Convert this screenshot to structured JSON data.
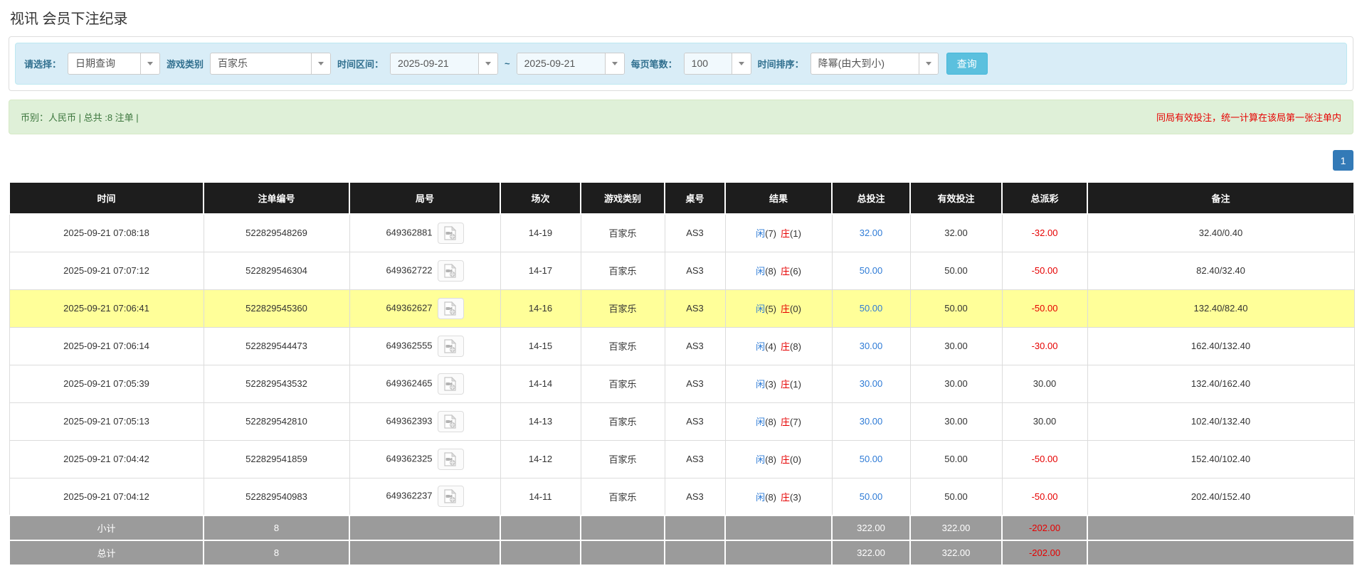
{
  "page": {
    "title": "视讯 会员下注纪录"
  },
  "colors": {
    "accent_button_blue": "#5bc0de",
    "pagination_blue": "#337ab7",
    "link_blue": "#2e7bd6",
    "negative_red": "#e60000",
    "highlight_yellow": "#ffff99",
    "header_black": "#1d1d1d",
    "footer_gray": "#9b9b9b",
    "filter_bg": "#d9edf7",
    "summary_bg": "#dff0d8"
  },
  "filters": {
    "select_label": "请选择：",
    "select_value": "日期查询",
    "game_label": "游戏类别",
    "game_value": "百家乐",
    "range_label": "时间区间：",
    "date_from": "2025-09-21",
    "date_separator": "~",
    "date_to": "2025-09-21",
    "page_size_label": "每页笔数：",
    "page_size_value": "100",
    "sort_label": "时间排序：",
    "sort_value": "降幂(由大到小)",
    "search_button": "查询"
  },
  "summary": {
    "left_text": "币别：人民币 | 总共 :8 注单 |",
    "notice": "同局有效投注，统一计算在该局第一张注单内"
  },
  "pagination": {
    "current": "1"
  },
  "table": {
    "headers": [
      "时间",
      "注单编号",
      "局号",
      "场次",
      "游戏类别",
      "桌号",
      "结果",
      "总投注",
      "有效投注",
      "总派彩",
      "备注"
    ],
    "rows": [
      {
        "time": "2025-09-21 07:08:18",
        "bet_id": "522829548269",
        "round_id": "649362881",
        "session": "14-19",
        "game": "百家乐",
        "table_no": "AS3",
        "player": "闲",
        "player_score": "(7)",
        "banker": "庄",
        "banker_score": "(1)",
        "total_bet": "32.00",
        "valid_bet": "32.00",
        "payout": "-32.00",
        "note": "32.40/0.40",
        "highlight": false
      },
      {
        "time": "2025-09-21 07:07:12",
        "bet_id": "522829546304",
        "round_id": "649362722",
        "session": "14-17",
        "game": "百家乐",
        "table_no": "AS3",
        "player": "闲",
        "player_score": "(8)",
        "banker": "庄",
        "banker_score": "(6)",
        "total_bet": "50.00",
        "valid_bet": "50.00",
        "payout": "-50.00",
        "note": "82.40/32.40",
        "highlight": false
      },
      {
        "time": "2025-09-21 07:06:41",
        "bet_id": "522829545360",
        "round_id": "649362627",
        "session": "14-16",
        "game": "百家乐",
        "table_no": "AS3",
        "player": "闲",
        "player_score": "(5)",
        "banker": "庄",
        "banker_score": "(0)",
        "total_bet": "50.00",
        "valid_bet": "50.00",
        "payout": "-50.00",
        "note": "132.40/82.40",
        "highlight": true
      },
      {
        "time": "2025-09-21 07:06:14",
        "bet_id": "522829544473",
        "round_id": "649362555",
        "session": "14-15",
        "game": "百家乐",
        "table_no": "AS3",
        "player": "闲",
        "player_score": "(4)",
        "banker": "庄",
        "banker_score": "(8)",
        "total_bet": "30.00",
        "valid_bet": "30.00",
        "payout": "-30.00",
        "note": "162.40/132.40",
        "highlight": false
      },
      {
        "time": "2025-09-21 07:05:39",
        "bet_id": "522829543532",
        "round_id": "649362465",
        "session": "14-14",
        "game": "百家乐",
        "table_no": "AS3",
        "player": "闲",
        "player_score": "(3)",
        "banker": "庄",
        "banker_score": "(1)",
        "total_bet": "30.00",
        "valid_bet": "30.00",
        "payout": "30.00",
        "note": "132.40/162.40",
        "highlight": false
      },
      {
        "time": "2025-09-21 07:05:13",
        "bet_id": "522829542810",
        "round_id": "649362393",
        "session": "14-13",
        "game": "百家乐",
        "table_no": "AS3",
        "player": "闲",
        "player_score": "(8)",
        "banker": "庄",
        "banker_score": "(7)",
        "total_bet": "30.00",
        "valid_bet": "30.00",
        "payout": "30.00",
        "note": "102.40/132.40",
        "highlight": false
      },
      {
        "time": "2025-09-21 07:04:42",
        "bet_id": "522829541859",
        "round_id": "649362325",
        "session": "14-12",
        "game": "百家乐",
        "table_no": "AS3",
        "player": "闲",
        "player_score": "(8)",
        "banker": "庄",
        "banker_score": "(0)",
        "total_bet": "50.00",
        "valid_bet": "50.00",
        "payout": "-50.00",
        "note": "152.40/102.40",
        "highlight": false
      },
      {
        "time": "2025-09-21 07:04:12",
        "bet_id": "522829540983",
        "round_id": "649362237",
        "session": "14-11",
        "game": "百家乐",
        "table_no": "AS3",
        "player": "闲",
        "player_score": "(8)",
        "banker": "庄",
        "banker_score": "(3)",
        "total_bet": "50.00",
        "valid_bet": "50.00",
        "payout": "-50.00",
        "note": "202.40/152.40",
        "highlight": false
      }
    ],
    "footer": [
      {
        "label": "小计",
        "count": "8",
        "total_bet": "322.00",
        "valid_bet": "322.00",
        "payout": "-202.00"
      },
      {
        "label": "总计",
        "count": "8",
        "total_bet": "322.00",
        "valid_bet": "322.00",
        "payout": "-202.00"
      }
    ]
  }
}
